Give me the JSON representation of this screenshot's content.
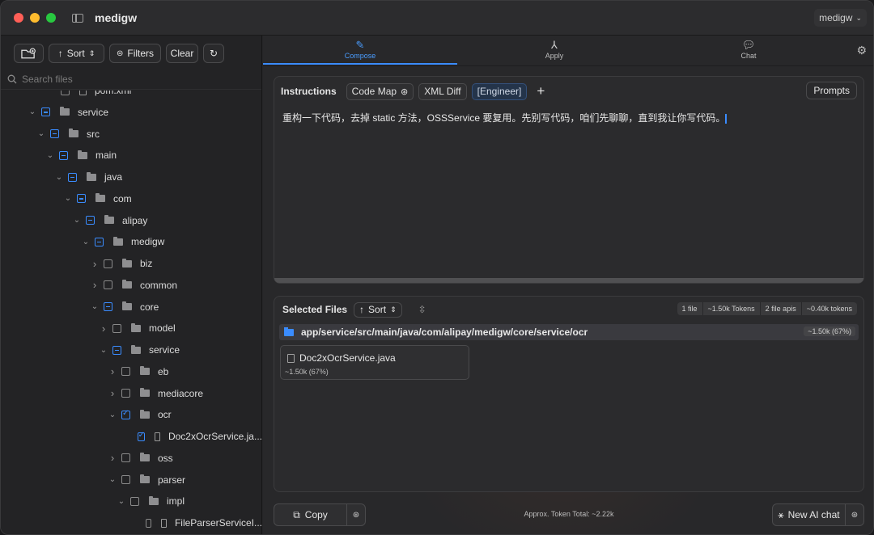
{
  "window": {
    "title": "medigw",
    "workspace": "medigw"
  },
  "sidebar": {
    "toolbar": {
      "sort_label": "Sort",
      "filters_label": "Filters",
      "clear_label": "Clear"
    },
    "search": {
      "placeholder": "Search files"
    },
    "tree": [
      {
        "label": "pom.xml",
        "type": "file",
        "check": "none",
        "chev": ""
      },
      {
        "label": "service",
        "type": "folder",
        "check": "partial",
        "chev": "down"
      },
      {
        "label": "src",
        "type": "folder",
        "check": "partial",
        "chev": "down"
      },
      {
        "label": "main",
        "type": "folder",
        "check": "partial",
        "chev": "down"
      },
      {
        "label": "java",
        "type": "folder",
        "check": "partial",
        "chev": "down"
      },
      {
        "label": "com",
        "type": "folder",
        "check": "partial",
        "chev": "down"
      },
      {
        "label": "alipay",
        "type": "folder",
        "check": "partial",
        "chev": "down"
      },
      {
        "label": "medigw",
        "type": "folder",
        "check": "partial",
        "chev": "down"
      },
      {
        "label": "biz",
        "type": "folder",
        "check": "none",
        "chev": "right"
      },
      {
        "label": "common",
        "type": "folder",
        "check": "none",
        "chev": "right"
      },
      {
        "label": "core",
        "type": "folder",
        "check": "partial",
        "chev": "down"
      },
      {
        "label": "model",
        "type": "folder",
        "check": "none",
        "chev": "right"
      },
      {
        "label": "service",
        "type": "folder",
        "check": "partial",
        "chev": "down"
      },
      {
        "label": "eb",
        "type": "folder",
        "check": "none",
        "chev": "right"
      },
      {
        "label": "mediacore",
        "type": "folder",
        "check": "none",
        "chev": "right"
      },
      {
        "label": "ocr",
        "type": "folder",
        "check": "checked",
        "chev": "down"
      },
      {
        "label": "Doc2xOcrService.ja...",
        "type": "file",
        "check": "checked",
        "chev": ""
      },
      {
        "label": "oss",
        "type": "folder",
        "check": "none",
        "chev": "right"
      },
      {
        "label": "parser",
        "type": "folder",
        "check": "none",
        "chev": "down"
      },
      {
        "label": "impl",
        "type": "folder",
        "check": "none",
        "chev": "down"
      },
      {
        "label": "FileParserServiceI...",
        "type": "file",
        "check": "none",
        "chev": ""
      }
    ]
  },
  "tabs": [
    {
      "label": "Compose",
      "icon": "pencil-icon"
    },
    {
      "label": "Apply",
      "icon": "merge-icon"
    },
    {
      "label": "Chat",
      "icon": "chat-bubbles-icon"
    }
  ],
  "instructions": {
    "title": "Instructions",
    "chips": {
      "code_map": "Code Map",
      "xml_diff": "XML Diff",
      "engineer": "[Engineer]"
    },
    "prompts_label": "Prompts",
    "text": "重构一下代码，去掉 static 方法，OSSService 要复用。先别写代码，咱们先聊聊，直到我让你写代码。"
  },
  "selected_files": {
    "title": "Selected Files",
    "sort_label": "Sort",
    "stats": {
      "files": "1 file",
      "tokens": "~1.50k Tokens",
      "apis": "2 file apis",
      "api_tokens": "~0.40k tokens"
    },
    "path": "app/service/src/main/java/com/alipay/medigw/core/service/ocr",
    "path_tokens": "~1.50k (67%)",
    "file_name": "Doc2xOcrService.java",
    "file_tokens": "~1.50k (67%)"
  },
  "footer": {
    "copy_label": "Copy",
    "token_total": "Approx. Token Total: ~2.22k",
    "new_chat_label": "New AI chat"
  },
  "colors": {
    "accent": "#3a8cff",
    "red": "#ff5f57",
    "yellow": "#febc2e",
    "green": "#28c840"
  }
}
